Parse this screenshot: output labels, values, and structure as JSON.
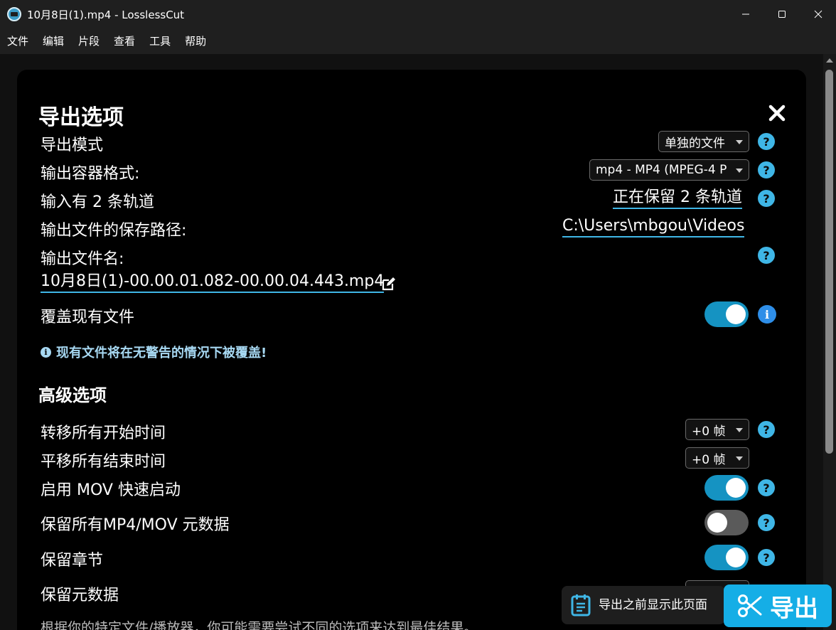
{
  "window": {
    "title": "10月8日(1).mp4 - LosslessCut",
    "minimize": "minimize-icon",
    "maximize": "maximize-icon",
    "close": "close-icon"
  },
  "menu": [
    "文件",
    "编辑",
    "片段",
    "查看",
    "工具",
    "帮助"
  ],
  "dialog": {
    "title": "导出选项",
    "export_mode": {
      "label": "导出模式",
      "value": "单独的文件"
    },
    "container_format": {
      "label": "输出容器格式:",
      "value": "mp4 - MP4 (MPEG-4 P"
    },
    "tracks": {
      "label": "输入有 2 条轨道",
      "value": "正在保留 2 条轨道"
    },
    "save_path": {
      "label": "输出文件的保存路径:",
      "value": "C:\\Users\\mbgou\\Videos"
    },
    "file_name": {
      "label": "输出文件名:",
      "value": "10月8日(1)-00.00.01.082-00.00.04.443.mp4"
    },
    "overwrite": {
      "label": "覆盖现有文件",
      "enabled": true,
      "warning": "现有文件将在无警告的情况下被覆盖!"
    },
    "advanced": {
      "title": "高级选项",
      "shift_start": {
        "label": "转移所有开始时间",
        "value": "+0 帧"
      },
      "shift_end": {
        "label": "平移所有结束时间",
        "value": "+0 帧"
      },
      "mov_faststart": {
        "label": "启用 MOV 快速启动",
        "enabled": true
      },
      "preserve_mp4_meta": {
        "label": "保留所有MP4/MOV 元数据",
        "enabled": false
      },
      "preserve_chapters": {
        "label": "保留章节",
        "enabled": true
      },
      "preserve_metadata": {
        "label": "保留元数据"
      }
    },
    "footer_hint": "根据你的特定文件/播放器，你可能需要尝试不同的选项来达到最佳结果。"
  },
  "bottom": {
    "show_before_label": "导出之前显示此页面",
    "export_label": "导出"
  },
  "colors": {
    "accent": "#15aee6",
    "help": "#3fb6e6",
    "toggle_on": "#1593c2",
    "toggle_off": "#5a5a5a"
  }
}
